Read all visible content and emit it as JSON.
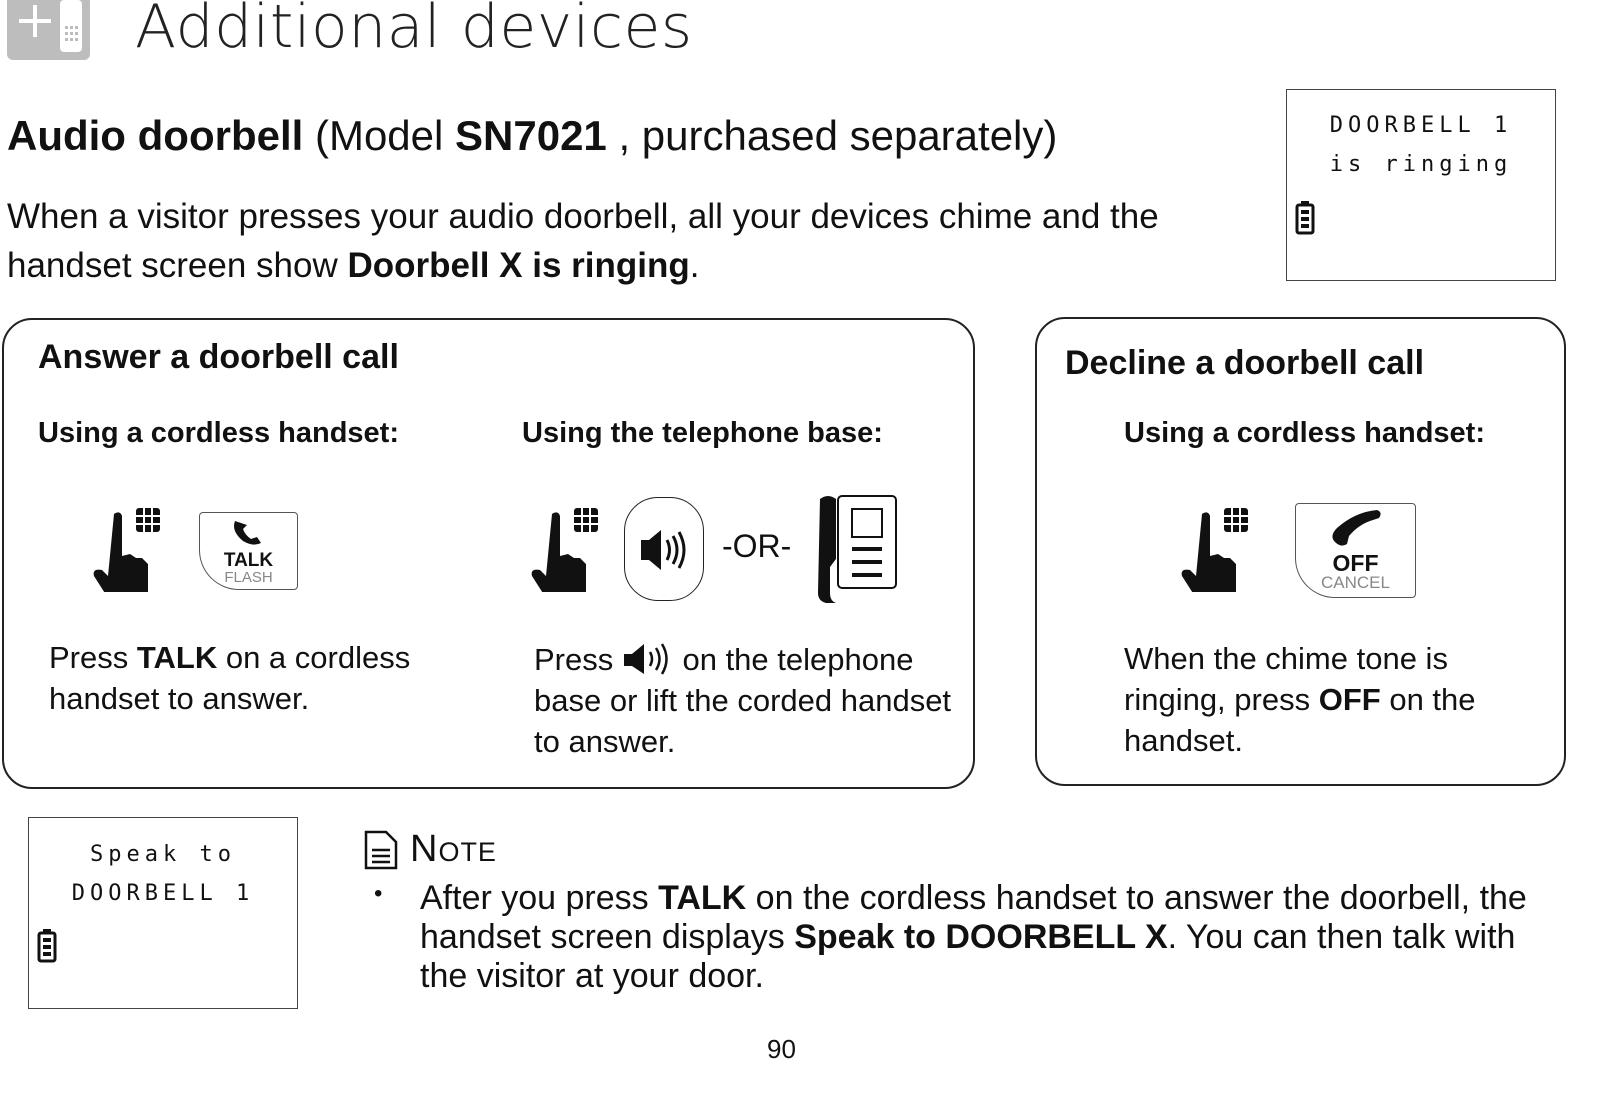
{
  "header": {
    "title": "Additional devices",
    "icon": "add-device-icon"
  },
  "section": {
    "title_bold": "Audio doorbell",
    "title_model_prefix": " (Model ",
    "model": "SN7021",
    "title_suffix": " , purchased separately)",
    "body_1": "When a visitor presses your audio doorbell, all your devices chime and the handset screen show ",
    "body_bold": "Doorbell X is ringing",
    "body_end": "."
  },
  "lcd_top": {
    "line1": "DOORBELL 1",
    "line2": "is ringing"
  },
  "answer": {
    "title": "Answer a doorbell call",
    "handset": {
      "heading": "Using a cordless handset:",
      "button_main": "TALK",
      "button_sub": "FLASH",
      "text_pre": "Press ",
      "text_bold": "TALK",
      "text_post": " on a cordless handset to answer."
    },
    "base": {
      "heading": "Using the telephone base:",
      "or": "-OR-",
      "text_pre": "Press ",
      "text_post": " on the telephone base or lift the corded handset to answer."
    }
  },
  "decline": {
    "title": "Decline a doorbell call",
    "heading": "Using a cordless handset:",
    "button_main": "OFF",
    "button_sub": "CANCEL",
    "text_pre": "When the chime tone is ringing, press ",
    "text_bold": "OFF",
    "text_post": " on the handset."
  },
  "lcd_bottom": {
    "line1": "Speak to",
    "line2": "DOORBELL 1"
  },
  "note": {
    "heading": "Note",
    "bullet": "•",
    "t1": "After you press ",
    "b1": "TALK",
    "t2": " on the cordless handset to answer the doorbell, the handset screen displays ",
    "b2": "Speak to DOORBELL X",
    "t3": ". You can then talk with the visitor at your door."
  },
  "page_number": "90"
}
